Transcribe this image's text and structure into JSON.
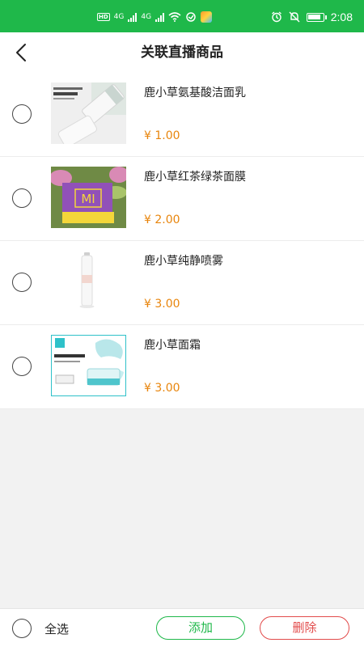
{
  "status_bar": {
    "time": "2:08",
    "network_1": "4G",
    "network_2": "4G"
  },
  "header": {
    "title": "关联直播商品",
    "back_icon": "chevron-left-icon"
  },
  "products": [
    {
      "name": "鹿小草氨基酸洁面乳",
      "price": "¥ 1.00",
      "thumb_text": "氨基酸洁面"
    },
    {
      "name": "鹿小草红茶绿茶面膜",
      "price": "¥ 2.00",
      "thumb_text": "MI"
    },
    {
      "name": "鹿小草纯静喷雾",
      "price": "¥ 3.00"
    },
    {
      "name": "鹿小草面霜",
      "price": "¥ 3.00",
      "thumb_text": "一夜回春"
    }
  ],
  "bottom_bar": {
    "select_all_label": "全选",
    "add_label": "添加",
    "delete_label": "删除"
  },
  "colors": {
    "brand_green": "#1fb84a",
    "price_orange": "#e8850c",
    "delete_red": "#e24b4b"
  }
}
